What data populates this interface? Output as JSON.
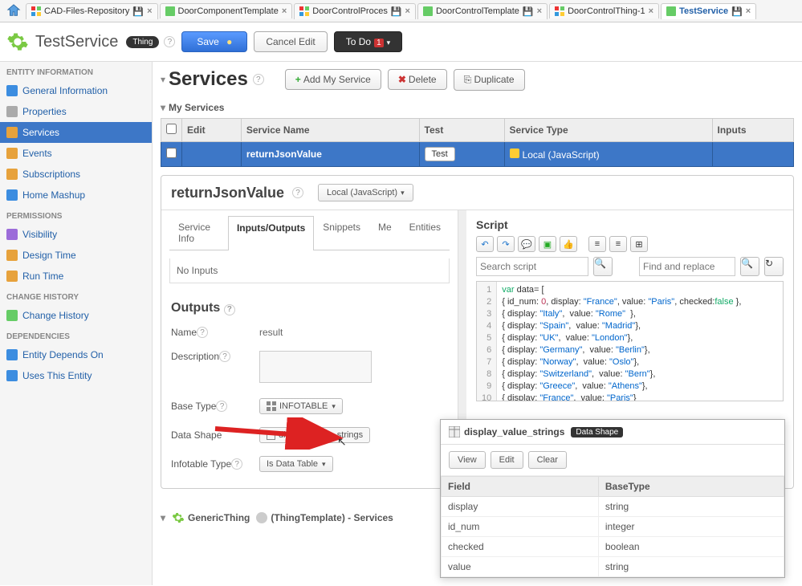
{
  "tabs": [
    {
      "label": "CAD-Files-Repository",
      "icon": "multi"
    },
    {
      "label": "DoorComponentTemplate",
      "icon": "green"
    },
    {
      "label": "DoorControlProces",
      "icon": "multi"
    },
    {
      "label": "DoorControlTemplate",
      "icon": "green"
    },
    {
      "label": "DoorControlThing-1",
      "icon": "multi"
    },
    {
      "label": "TestService",
      "icon": "green",
      "active": true
    }
  ],
  "header": {
    "entityName": "TestService",
    "pill": "Thing",
    "save": "Save",
    "cancel": "Cancel Edit",
    "todo": "To Do",
    "todoBadge": "1"
  },
  "sidebar": {
    "sections": [
      {
        "title": "ENTITY INFORMATION",
        "items": [
          {
            "label": "General Information",
            "icon": "blue"
          },
          {
            "label": "Properties",
            "icon": "grey"
          },
          {
            "label": "Services",
            "icon": "orange",
            "active": true
          },
          {
            "label": "Events",
            "icon": "orange"
          },
          {
            "label": "Subscriptions",
            "icon": "orange"
          },
          {
            "label": "Home Mashup",
            "icon": "blue"
          }
        ]
      },
      {
        "title": "PERMISSIONS",
        "items": [
          {
            "label": "Visibility",
            "icon": "purple"
          },
          {
            "label": "Design Time",
            "icon": "orange"
          },
          {
            "label": "Run Time",
            "icon": "orange"
          }
        ]
      },
      {
        "title": "CHANGE HISTORY",
        "items": [
          {
            "label": "Change History",
            "icon": "green"
          }
        ]
      },
      {
        "title": "DEPENDENCIES",
        "items": [
          {
            "label": "Entity Depends On",
            "icon": "blue"
          },
          {
            "label": "Uses This Entity",
            "icon": "blue"
          }
        ]
      }
    ]
  },
  "page": {
    "title": "Services",
    "addBtn": "Add My Service",
    "delBtn": "Delete",
    "dupBtn": "Duplicate",
    "mySvcs": "My Services"
  },
  "svcTable": {
    "headers": {
      "edit": "Edit",
      "name": "Service Name",
      "test": "Test",
      "type": "Service Type",
      "inputs": "Inputs"
    },
    "row": {
      "name": "returnJsonValue",
      "testBtn": "Test",
      "type": "Local (JavaScript)",
      "inputs": ""
    }
  },
  "editor": {
    "svcName": "returnJsonValue",
    "handlerBtn": "Local (JavaScript)",
    "tabs": {
      "info": "Service Info",
      "io": "Inputs/Outputs",
      "snip": "Snippets",
      "me": "Me",
      "ent": "Entities"
    },
    "noInputs": "No Inputs",
    "outputsTitle": "Outputs",
    "labels": {
      "name": "Name",
      "desc": "Description",
      "baseType": "Base Type",
      "dataShape": "Data Shape",
      "infotable": "Infotable Type"
    },
    "values": {
      "name": "result",
      "baseType": "INFOTABLE",
      "dataShape": "display_value_strings",
      "infotable": "Is Data Table"
    }
  },
  "script": {
    "title": "Script",
    "searchPh": "Search script",
    "findPh": "Find and replace",
    "lines": [
      "var data= [",
      "{ id_num: 0, display: \"France\", value: \"Paris\", checked:false },",
      "{ display: \"Italy\",  value: \"Rome\"  },",
      "{ display: \"Spain\",  value: \"Madrid\"},",
      "{ display: \"UK\",  value: \"London\"},",
      "{ display: \"Germany\",  value: \"Berlin\"},",
      "{ display: \"Norway\",  value: \"Oslo\"},",
      "{ display: \"Switzerland\",  value: \"Bern\"},",
      "{ display: \"Greece\",  value: \"Athens\"},",
      "{ display: \"France\",  value: \"Paris\"}",
      ""
    ]
  },
  "popup": {
    "title": "display_value_strings",
    "badge": "Data Shape",
    "btns": {
      "view": "View",
      "edit": "Edit",
      "clear": "Clear"
    },
    "th": {
      "field": "Field",
      "base": "BaseType"
    },
    "rows": [
      {
        "field": "display",
        "base": "string"
      },
      {
        "field": "id_num",
        "base": "integer"
      },
      {
        "field": "checked",
        "base": "boolean"
      },
      {
        "field": "value",
        "base": "string"
      }
    ]
  },
  "footer": {
    "genericThing": "GenericThing",
    "template": "(ThingTemplate) - Services"
  }
}
